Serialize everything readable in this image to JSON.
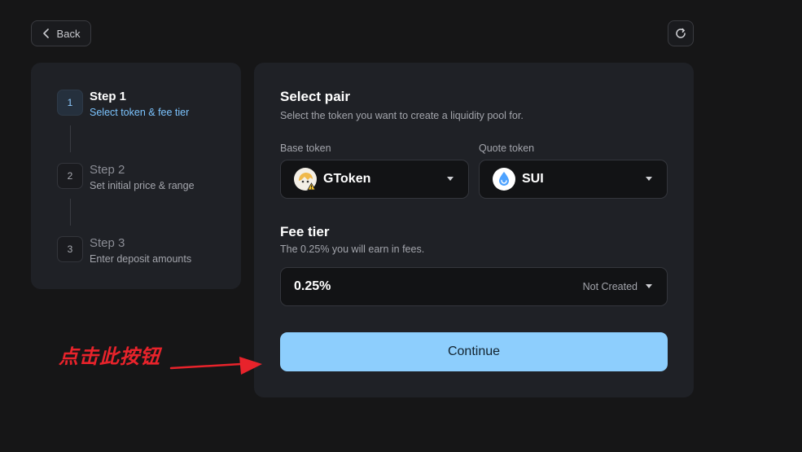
{
  "header": {
    "back_label": "Back",
    "refresh_icon": "refresh-icon"
  },
  "stepper": {
    "steps": [
      {
        "number": "1",
        "title": "Step  1",
        "subtitle": "Select token & fee tier",
        "active": true
      },
      {
        "number": "2",
        "title": "Step  2",
        "subtitle": "Set initial price & range",
        "active": false
      },
      {
        "number": "3",
        "title": "Step  3",
        "subtitle": "Enter deposit amounts",
        "active": false
      }
    ]
  },
  "pair": {
    "title": "Select pair",
    "description": "Select the token you want to create a liquidity pool for.",
    "base": {
      "label": "Base token",
      "token": "GToken",
      "icon": "gtoken-icon"
    },
    "quote": {
      "label": "Quote token",
      "token": "SUI",
      "icon": "sui-icon"
    }
  },
  "fee": {
    "title": "Fee tier",
    "description": "The 0.25% you will earn in fees.",
    "value": "0.25%",
    "status": "Not Created"
  },
  "continue_label": "Continue",
  "annotation": {
    "text": "点击此按钮",
    "color": "#e8232b"
  },
  "colors": {
    "background": "#161617",
    "card": "#1f2126",
    "accent": "#8dcefd",
    "active_step": "#7cc4ff"
  }
}
